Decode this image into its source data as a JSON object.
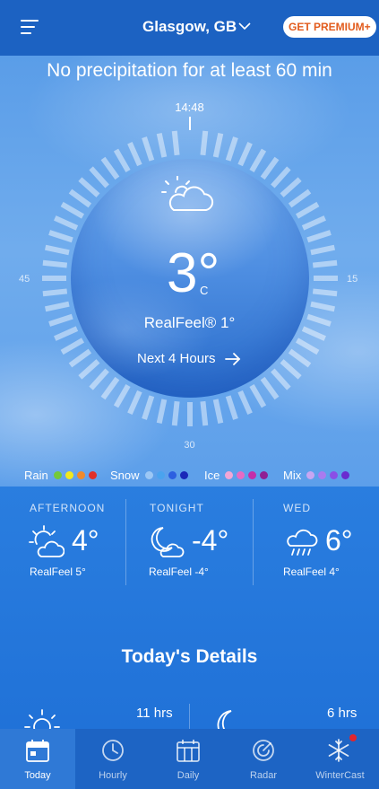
{
  "header": {
    "location": "Glasgow, GB",
    "premium_label": "GET PREMIUM+"
  },
  "minutecast": {
    "title": "No precipitation for at least 60 min",
    "time_label": "14:48",
    "label_left": "45",
    "label_right": "15",
    "label_bottom": "30"
  },
  "current": {
    "temperature": "3°",
    "unit": "C",
    "realfeel": "RealFeel® 1°",
    "next_hours_label": "Next 4 Hours",
    "icon": "partly-cloudy-icon"
  },
  "legend": [
    {
      "label": "Rain",
      "colors": [
        "#74c93a",
        "#f2e81e",
        "#f08a2c",
        "#e0302a"
      ]
    },
    {
      "label": "Snow",
      "colors": [
        "#9cc7f5",
        "#4aa3ee",
        "#2c5fe0",
        "#1a28b8"
      ]
    },
    {
      "label": "Ice",
      "colors": [
        "#f2a6d6",
        "#e66bc4",
        "#c42ea9",
        "#8f1f94"
      ]
    },
    {
      "label": "Mix",
      "colors": [
        "#c8a6f2",
        "#a97bef",
        "#8a4fe6",
        "#6a2bcf"
      ]
    }
  ],
  "forecast": [
    {
      "title": "AFTERNOON",
      "temp": "4°",
      "realfeel": "RealFeel 5°",
      "icon": "sun-cloud-icon"
    },
    {
      "title": "TONIGHT",
      "temp": "-4°",
      "realfeel": "RealFeel -4°",
      "icon": "moon-cloud-icon"
    },
    {
      "title": "WED",
      "temp": "6°",
      "realfeel": "RealFeel 4°",
      "icon": "rain-cloud-icon"
    }
  ],
  "details": {
    "title": "Today's Details",
    "sun_duration": "11 hrs",
    "moon_duration": "6 hrs"
  },
  "nav": [
    {
      "label": "Today",
      "icon": "calendar-today-icon",
      "active": true
    },
    {
      "label": "Hourly",
      "icon": "clock-icon",
      "active": false
    },
    {
      "label": "Daily",
      "icon": "calendar-icon",
      "active": false
    },
    {
      "label": "Radar",
      "icon": "radar-icon",
      "active": false
    },
    {
      "label": "WinterCast",
      "icon": "snowflake-icon",
      "active": false
    }
  ],
  "colors": {
    "header_bg": "#1c62c2",
    "premium_text": "#e25b1c",
    "nav_bg": "#1d64c4",
    "badge": "#e0252d"
  }
}
